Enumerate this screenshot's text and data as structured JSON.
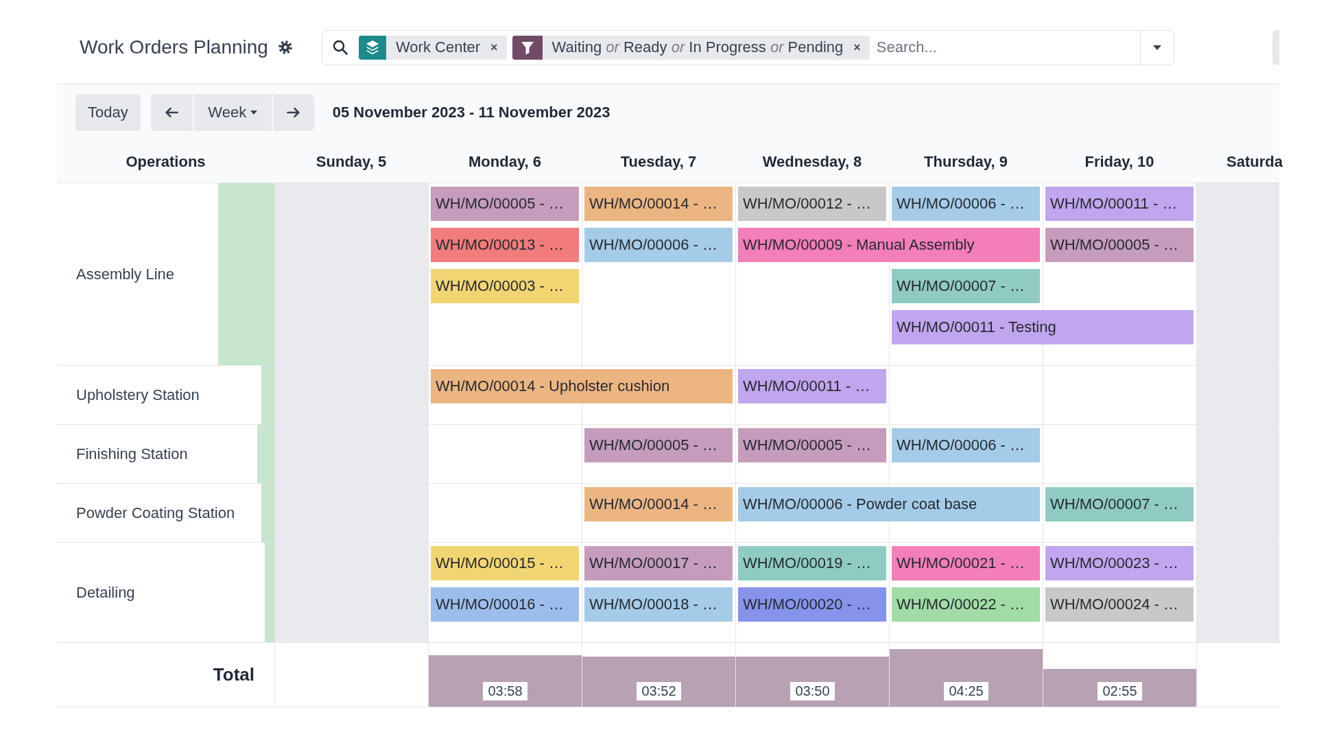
{
  "header": {
    "title": "Work Orders Planning",
    "search": {
      "facets": [
        {
          "kind": "group",
          "label": "Work Center",
          "remove": "×"
        },
        {
          "kind": "filter",
          "label": "Waiting *or* Ready *or* In Progress *or* Pending",
          "remove": "×"
        }
      ],
      "placeholder": "Search..."
    }
  },
  "toolbar": {
    "today": "Today",
    "scale": "Week",
    "date_range": "05 November 2023 - 11 November 2023"
  },
  "gantt": {
    "row_heading": "Operations",
    "columns": [
      {
        "label": "Sunday, 5",
        "working": false
      },
      {
        "label": "Monday, 6",
        "working": true
      },
      {
        "label": "Tuesday, 7",
        "working": true
      },
      {
        "label": "Wednesday, 8",
        "working": true
      },
      {
        "label": "Thursday, 9",
        "working": true
      },
      {
        "label": "Friday, 10",
        "working": true
      },
      {
        "label": "Saturda",
        "working": false
      }
    ],
    "rows": [
      {
        "name": "Assembly Line",
        "level": 0.26,
        "lanes": [
          [
            {
              "kind": "empty"
            },
            {
              "kind": "task",
              "label": "WH/MO/00005 - …",
              "color": "#c59cbb",
              "multi_day": false
            },
            {
              "kind": "task",
              "label": "WH/MO/00014 - …",
              "color": "#ebb582",
              "multi_day": false
            },
            {
              "kind": "task",
              "label": "WH/MO/00012 - …",
              "color": "#c8c8c8",
              "multi_day": false
            },
            {
              "kind": "task",
              "label": "WH/MO/00006 - …",
              "color": "#a4cbe8",
              "multi_day": false
            },
            {
              "kind": "task",
              "label": "WH/MO/00011 - …",
              "color": "#c1a5ee",
              "multi_day": false
            }
          ],
          [
            {
              "kind": "empty"
            },
            {
              "kind": "task",
              "label": "WH/MO/00013 - …",
              "color": "#f27b7b",
              "multi_day": false
            },
            {
              "kind": "task",
              "label": "WH/MO/00006 - …",
              "color": "#a4cbe8",
              "multi_day": false
            },
            {
              "kind": "task",
              "label": "WH/MO/00009 - Manual Assembly",
              "color": "#f47eb8",
              "multi_day": true
            },
            {
              "kind": "task",
              "label": "WH/MO/00005 - …",
              "color": "#c59cbb",
              "multi_day": false
            }
          ],
          [
            {
              "kind": "empty"
            },
            {
              "kind": "task",
              "label": "WH/MO/00003 - …",
              "color": "#f1d573",
              "multi_day": false
            },
            {
              "kind": "empty"
            },
            {
              "kind": "empty"
            },
            {
              "kind": "task",
              "label": "WH/MO/00007 - …",
              "color": "#8fcbc3",
              "multi_day": false
            }
          ],
          [
            {
              "kind": "empty"
            },
            {
              "kind": "empty"
            },
            {
              "kind": "empty"
            },
            {
              "kind": "empty"
            },
            {
              "kind": "task",
              "label": "WH/MO/00011 - Testing",
              "color": "#c1a5ee",
              "multi_day": true
            }
          ]
        ]
      },
      {
        "name": "Upholstery Station",
        "level": 0.06,
        "lanes": [
          [
            {
              "kind": "empty"
            },
            {
              "kind": "task",
              "label": "WH/MO/00014 - Upholster cushion",
              "color": "#ebb582",
              "multi_day": true
            },
            {
              "kind": "task",
              "label": "WH/MO/00011 - …",
              "color": "#c1a5ee",
              "multi_day": false
            }
          ]
        ]
      },
      {
        "name": "Finishing Station",
        "level": 0.08,
        "lanes": [
          [
            {
              "kind": "empty"
            },
            {
              "kind": "empty"
            },
            {
              "kind": "task",
              "label": "WH/MO/00005 - …",
              "color": "#c59cbb",
              "multi_day": false
            },
            {
              "kind": "task",
              "label": "WH/MO/00005 - …",
              "color": "#c59cbb",
              "multi_day": false
            },
            {
              "kind": "task",
              "label": "WH/MO/00006 - …",
              "color": "#a4cbe8",
              "multi_day": false
            }
          ]
        ]
      },
      {
        "name": "Powder Coating Station",
        "level": 0.06,
        "lanes": [
          [
            {
              "kind": "empty"
            },
            {
              "kind": "empty"
            },
            {
              "kind": "task",
              "label": "WH/MO/00014 - …",
              "color": "#ebb582",
              "multi_day": false
            },
            {
              "kind": "task",
              "label": "WH/MO/00006 - Powder coat base",
              "color": "#a4cbe8",
              "multi_day": true
            },
            {
              "kind": "task",
              "label": "WH/MO/00007 - …",
              "color": "#8fcbc3",
              "multi_day": false
            }
          ]
        ]
      },
      {
        "name": "Detailing",
        "level": 0.045,
        "lanes": [
          [
            {
              "kind": "empty"
            },
            {
              "kind": "task",
              "label": "WH/MO/00015 - …",
              "color": "#f1d573",
              "multi_day": false
            },
            {
              "kind": "task",
              "label": "WH/MO/00017 - …",
              "color": "#c59cbb",
              "multi_day": false
            },
            {
              "kind": "task",
              "label": "WH/MO/00019 - …",
              "color": "#8fcbc3",
              "multi_day": false
            },
            {
              "kind": "task",
              "label": "WH/MO/00021 - …",
              "color": "#f47eb8",
              "multi_day": false
            },
            {
              "kind": "task",
              "label": "WH/MO/00023 - …",
              "color": "#c1a5ee",
              "multi_day": false
            }
          ],
          [
            {
              "kind": "empty"
            },
            {
              "kind": "task",
              "label": "WH/MO/00016 - …",
              "color": "#9cbdeb",
              "multi_day": false
            },
            {
              "kind": "task",
              "label": "WH/MO/00018 - …",
              "color": "#a4cbe8",
              "multi_day": false
            },
            {
              "kind": "task",
              "label": "WH/MO/00020 - …",
              "color": "#8693eb",
              "multi_day": false
            },
            {
              "kind": "task",
              "label": "WH/MO/00022 - …",
              "color": "#a1dca6",
              "multi_day": false
            },
            {
              "kind": "task",
              "label": "WH/MO/00024 - …",
              "color": "#c8c8c8",
              "multi_day": false
            }
          ]
        ]
      }
    ],
    "total": {
      "label": "Total",
      "cells": [
        {
          "kind": "empty"
        },
        {
          "kind": "bar",
          "value": "03:58"
        },
        {
          "kind": "bar",
          "value": "03:52"
        },
        {
          "kind": "bar",
          "value": "03:50"
        },
        {
          "kind": "bar",
          "value": "04:25"
        },
        {
          "kind": "bar",
          "value": "02:55"
        },
        {
          "kind": "empty"
        }
      ]
    }
  }
}
